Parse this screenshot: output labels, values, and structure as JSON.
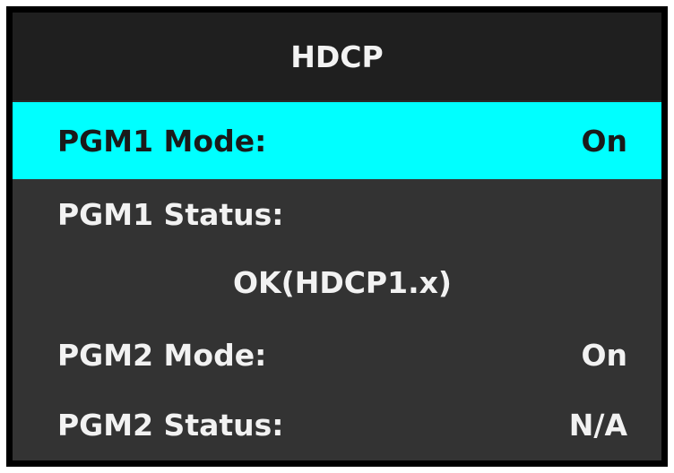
{
  "title": "HDCP",
  "menu": {
    "pgm1_mode": {
      "label": "PGM1 Mode:",
      "value": "On"
    },
    "pgm1_status": {
      "label": "PGM1 Status:",
      "value": "OK(HDCP1.x)"
    },
    "pgm2_mode": {
      "label": "PGM2 Mode:",
      "value": "On"
    },
    "pgm2_status": {
      "label": "PGM2 Status:",
      "value": "N/A"
    }
  },
  "colors": {
    "highlight": "#00ffff",
    "background": "#333333",
    "title_bar": "#1f1f1f",
    "text": "#f2f2f2"
  }
}
